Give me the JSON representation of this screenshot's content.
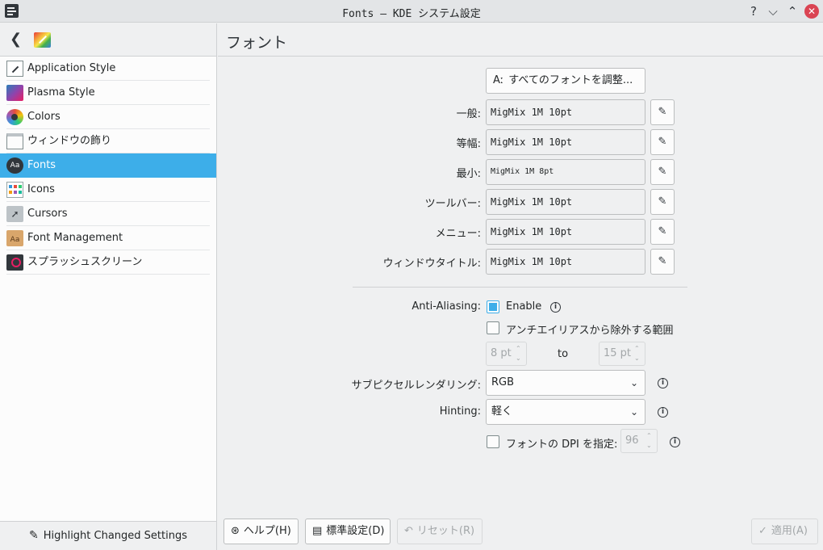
{
  "window": {
    "title": "Fonts – KDE システム設定",
    "help_glyph": "?",
    "minimize_glyph": "⌵",
    "maximize_glyph": "⌃",
    "close_glyph": "✕"
  },
  "sidebar": {
    "back_glyph": "❮",
    "items": [
      {
        "label": "Application Style",
        "icon": "application-style-icon"
      },
      {
        "label": "Plasma Style",
        "icon": "plasma-style-icon"
      },
      {
        "label": "Colors",
        "icon": "colors-icon"
      },
      {
        "label": "ウィンドウの飾り",
        "icon": "window-decorations-icon"
      },
      {
        "label": "Fonts",
        "icon": "fonts-icon",
        "selected": true
      },
      {
        "label": "Icons",
        "icon": "icons-icon"
      },
      {
        "label": "Cursors",
        "icon": "cursors-icon"
      },
      {
        "label": "Font Management",
        "icon": "font-management-icon"
      },
      {
        "label": "スプラッシュスクリーン",
        "icon": "splash-screen-icon"
      }
    ],
    "fonts_icon_text": "Aa",
    "font_management_icon_text": "Aa",
    "footer_label": "Highlight Changed Settings"
  },
  "main": {
    "title": "フォント",
    "adjust_all_label": "すべてのフォントを調整...",
    "adjust_all_glyph": "Aː",
    "font_rows": [
      {
        "label": "一般:",
        "value": "MigMix 1M 10pt"
      },
      {
        "label": "等幅:",
        "value": "MigMix 1M 10pt"
      },
      {
        "label": "最小:",
        "value": "MigMix 1M 8pt"
      },
      {
        "label": "ツールバー:",
        "value": "MigMix 1M 10pt"
      },
      {
        "label": "メニュー:",
        "value": "MigMix 1M 10pt"
      },
      {
        "label": "ウィンドウタイトル:",
        "value": "MigMix 1M 10pt"
      }
    ],
    "anti_aliasing": {
      "label": "Anti-Aliasing:",
      "enable_label": "Enable",
      "enabled": true,
      "exclude_label": "アンチエイリアスから除外する範囲",
      "exclude_checked": false,
      "from_value": "8 pt",
      "to_label": "to",
      "to_value": "15 pt"
    },
    "subpixel": {
      "label": "サブピクセルレンダリング:",
      "value": "RGB"
    },
    "hinting": {
      "label": "Hinting:",
      "value": "軽く"
    },
    "dpi": {
      "label": "フォントの DPI を指定:",
      "checked": false,
      "value": "96"
    },
    "info_glyph": "i"
  },
  "footer": {
    "help_label": "ヘルプ(H)",
    "defaults_label": "標準設定(D)",
    "reset_label": "リセット(R)",
    "apply_label": "適用(A)"
  },
  "colors": {
    "accent": "#3daee9",
    "close": "#da4453"
  }
}
